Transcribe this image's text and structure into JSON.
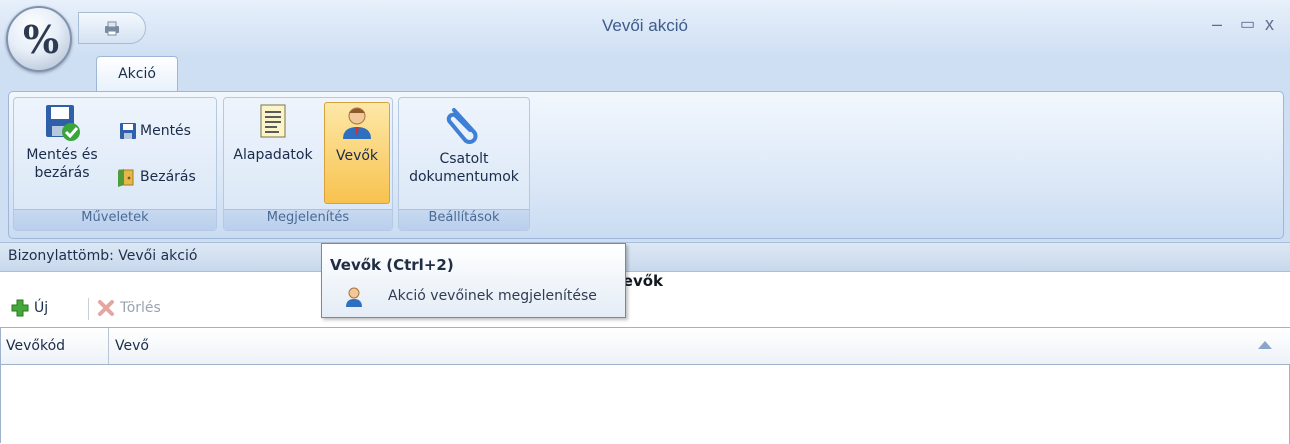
{
  "window": {
    "title": "Vevői akció",
    "min_symbol": "–",
    "max_symbol": "▭",
    "close_symbol": "x"
  },
  "app_logo": {
    "text": "%"
  },
  "tabs": [
    {
      "label": "Akció",
      "active": true
    }
  ],
  "ribbon": {
    "groups": [
      {
        "label": "Műveletek",
        "buttons": {
          "save_close": "Mentés és bezárás",
          "save": "Mentés",
          "close": "Bezárás"
        }
      },
      {
        "label": "Megjelenítés",
        "buttons": {
          "base_data": "Alapadatok",
          "customers": "Vevők"
        }
      },
      {
        "label": "Beállítások",
        "buttons": {
          "attached_docs": "Csatolt dokumentumok"
        }
      }
    ]
  },
  "info_bar": {
    "text": "Bizonylattömb: Vevői akció"
  },
  "section_title": "Vevők",
  "toolbar": {
    "new_label": "Új",
    "delete_label": "Törlés"
  },
  "grid": {
    "columns": [
      "Vevőkód",
      "Vevő"
    ],
    "rows": []
  },
  "tooltip": {
    "title": "Vevők (Ctrl+2)",
    "description": "Akció vevőinek megjelenítése"
  }
}
